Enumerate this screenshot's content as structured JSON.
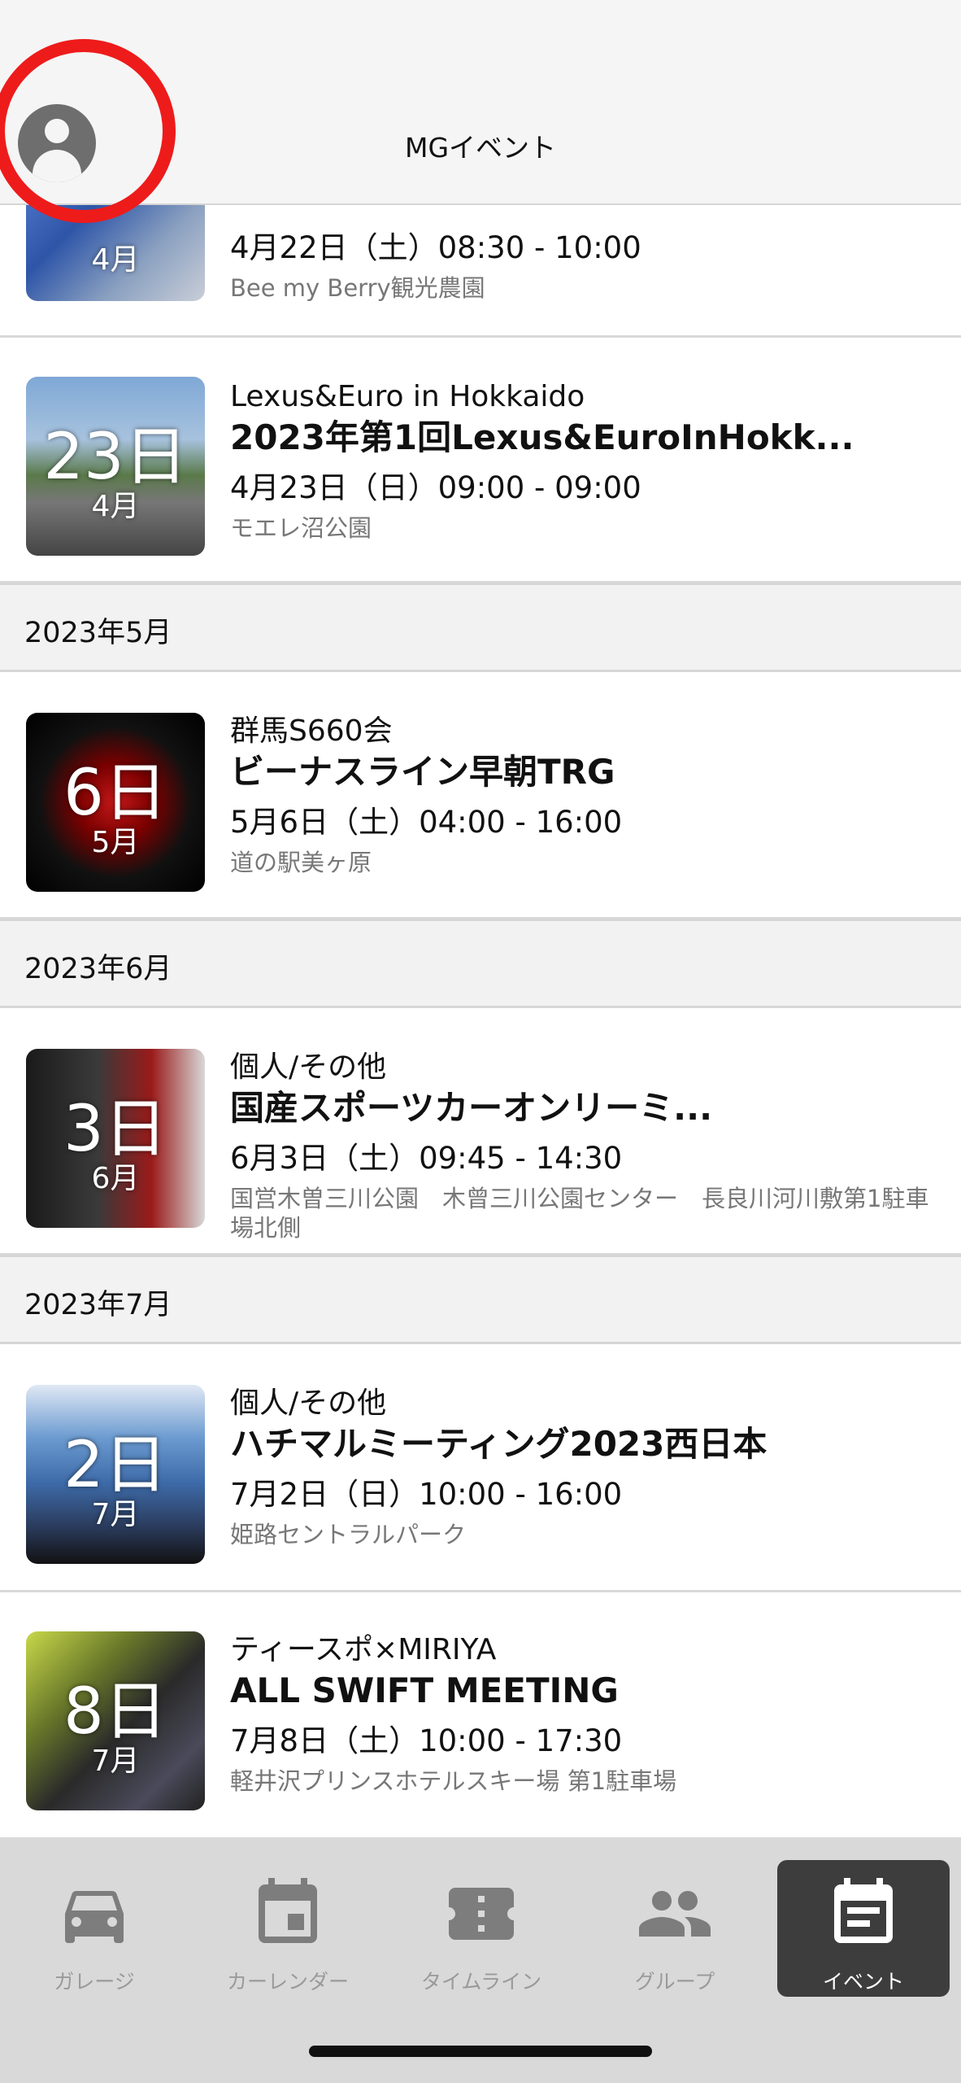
{
  "header": {
    "title": "MGイベント"
  },
  "colors": {
    "highlight_circle": "#ee1b1b",
    "active_tab_bg": "#3d3d3d",
    "tab_icon": "#7d7d7d"
  },
  "events_top": [
    {
      "day": "",
      "month": "4月",
      "organizer": "",
      "title": "",
      "time": "4月22日（土）08:30 - 10:00",
      "place": "Bee my Berry観光農園"
    },
    {
      "day": "23日",
      "month": "4月",
      "organizer": "Lexus&Euro in Hokkaido",
      "title": "2023年第1回Lexus&EuroInHokk...",
      "time": "4月23日（日）09:00 - 09:00",
      "place": "モエレ沼公園"
    }
  ],
  "sections": [
    {
      "month_label": "2023年5月",
      "events": [
        {
          "day": "6日",
          "month": "5月",
          "organizer": "群馬S660会",
          "title": "ビーナスライン早朝TRG",
          "time": "5月6日（土）04:00 - 16:00",
          "place": "道の駅美ヶ原"
        }
      ]
    },
    {
      "month_label": "2023年6月",
      "events": [
        {
          "day": "3日",
          "month": "6月",
          "organizer": "個人/その他",
          "title": "国産スポーツカーオンリーミ...",
          "time": "6月3日（土）09:45 - 14:30",
          "place": "国営木曽三川公園　木曾三川公園センター　長良川河川敷第1駐車場北側"
        }
      ]
    },
    {
      "month_label": "2023年7月",
      "events": [
        {
          "day": "2日",
          "month": "7月",
          "organizer": "個人/その他",
          "title": "ハチマルミーティング2023西日本",
          "time": "7月2日（日）10:00 - 16:00",
          "place": "姫路セントラルパーク"
        },
        {
          "day": "8日",
          "month": "7月",
          "organizer": "ティースポ×MIRIYA",
          "title": "ALL SWIFT MEETING",
          "time": "7月8日（土）10:00 - 17:30",
          "place": "軽井沢プリンスホテルスキー場 第1駐車場"
        }
      ]
    }
  ],
  "tabs": [
    {
      "label": "ガレージ",
      "icon": "car-icon"
    },
    {
      "label": "カーレンダー",
      "icon": "calendar-icon"
    },
    {
      "label": "タイムライン",
      "icon": "ticket-icon"
    },
    {
      "label": "グループ",
      "icon": "group-icon"
    },
    {
      "label": "イベント",
      "icon": "event-note-icon",
      "active": true
    }
  ]
}
